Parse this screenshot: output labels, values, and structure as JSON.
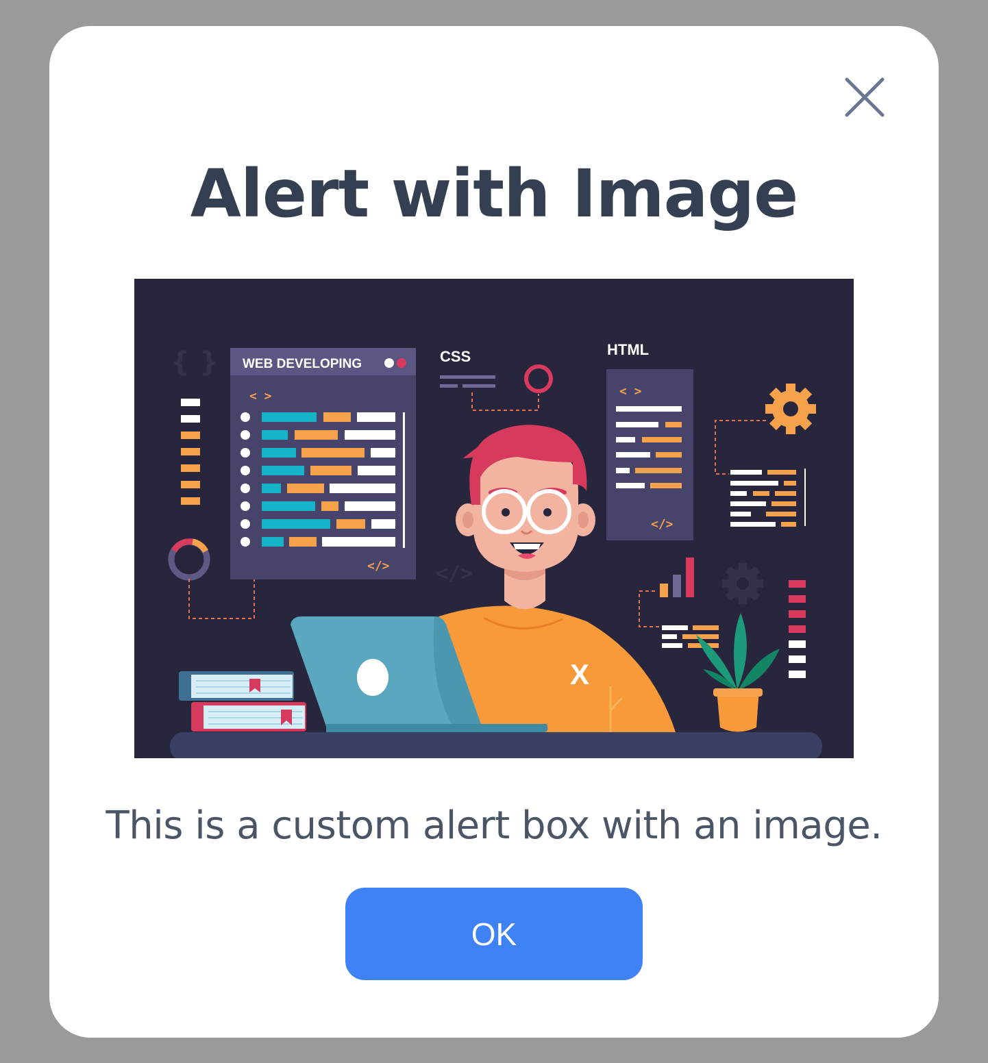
{
  "dialog": {
    "title": "Alert with Image",
    "message": "This is a custom alert box with an image.",
    "ok_label": "OK",
    "close_icon": "close-icon"
  },
  "illustration": {
    "window_title": "WEB DEVELOPING",
    "window_tag_open": "< >",
    "window_tag_close": "</>",
    "css_label": "CSS",
    "html_label": "HTML",
    "html_tag_open": "< >",
    "html_tag_close": "</>",
    "shirt_logo": "X",
    "faded_tag": "</>",
    "faded_braces": "{ }"
  },
  "colors": {
    "backdrop": "#9a9a9a",
    "dialog_bg": "#ffffff",
    "title": "#353f52",
    "message": "#4b5565",
    "button": "#3e82f5",
    "close_icon": "#6b7790",
    "illustration_bg": "#27263d"
  }
}
